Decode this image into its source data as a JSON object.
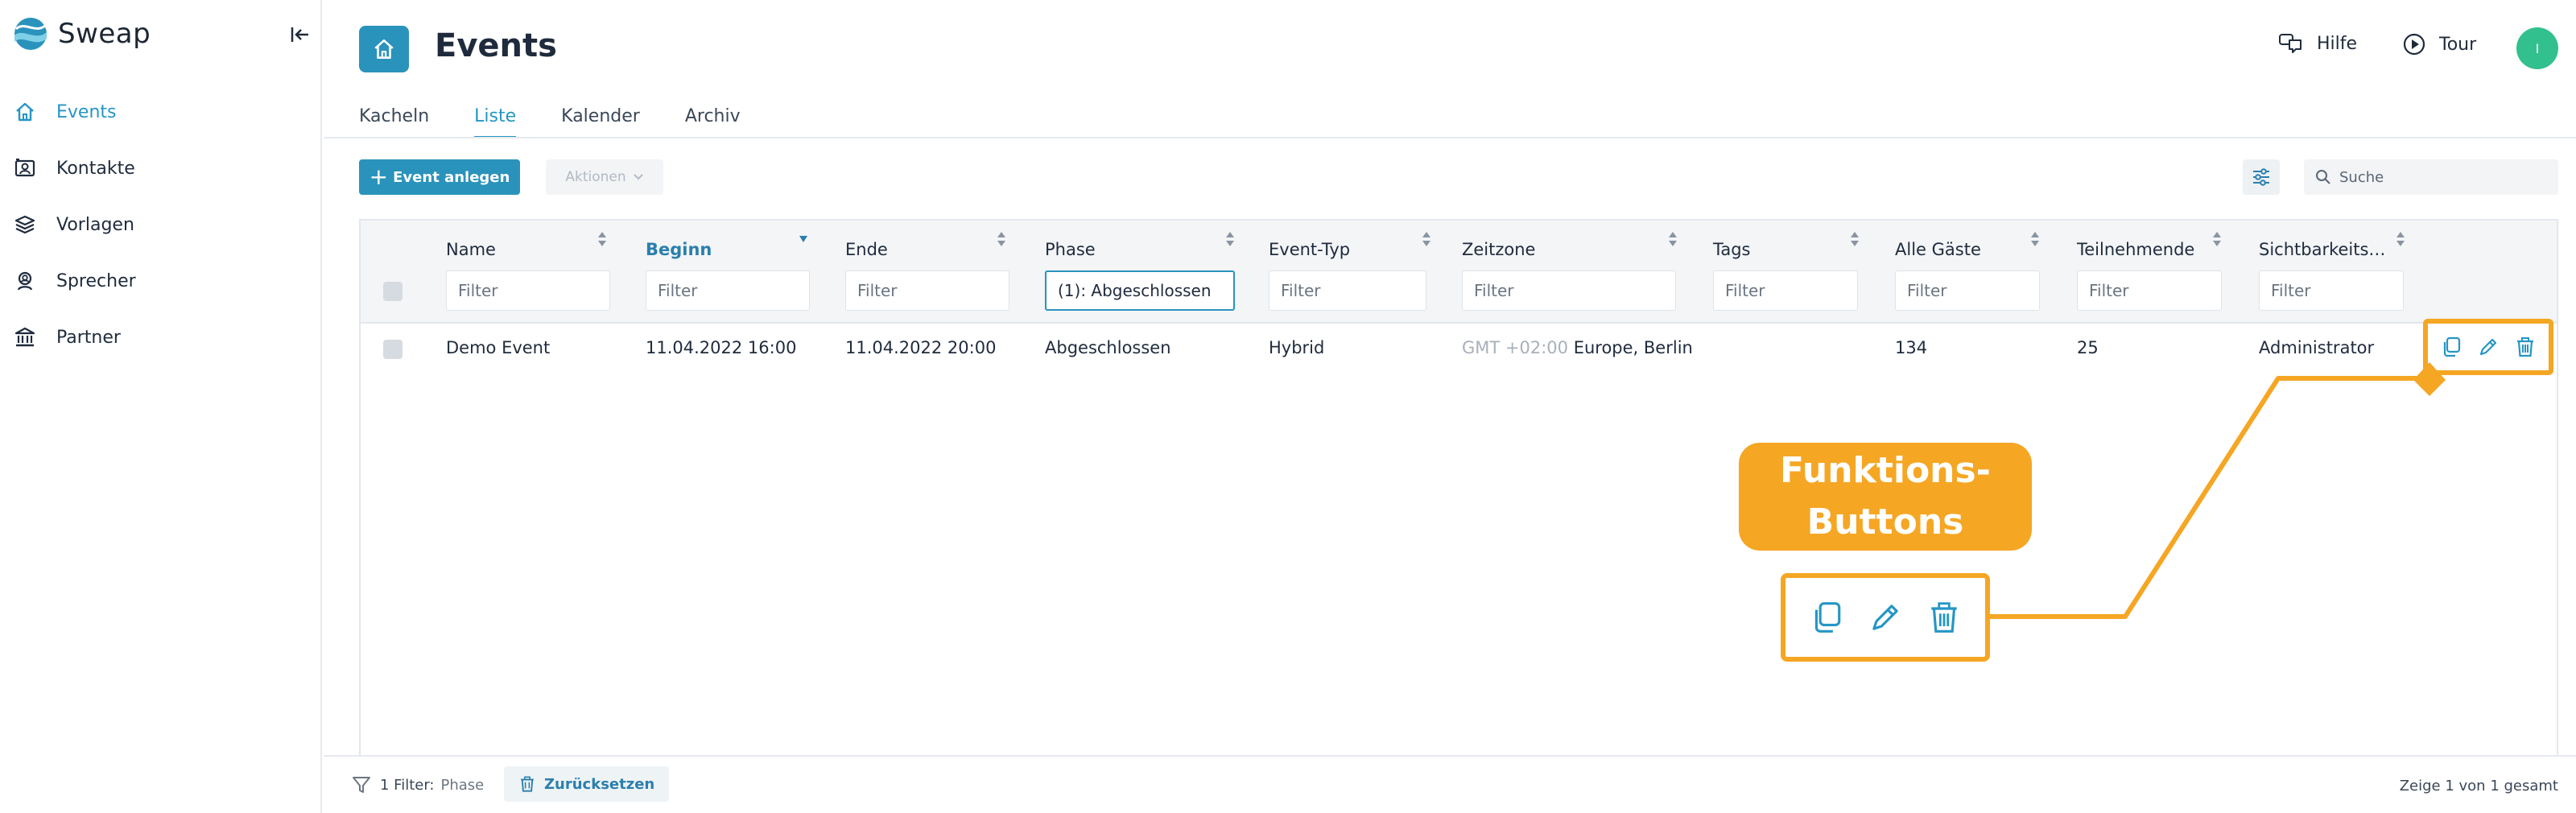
{
  "app": {
    "brand": "Sweap",
    "accent_color": "#2a93bc",
    "highlight_color": "#f5a623"
  },
  "sidebar": {
    "collapse_icon": "collapse-left-icon",
    "items": [
      {
        "label": "Events",
        "icon": "home-icon",
        "active": true
      },
      {
        "label": "Kontakte",
        "icon": "contact-card-icon",
        "active": false
      },
      {
        "label": "Vorlagen",
        "icon": "layers-icon",
        "active": false
      },
      {
        "label": "Sprecher",
        "icon": "speaker-icon",
        "active": false
      },
      {
        "label": "Partner",
        "icon": "bank-icon",
        "active": false
      }
    ]
  },
  "header": {
    "title": "Events",
    "help_label": "Hilfe",
    "tour_label": "Tour",
    "avatar_initial": "I"
  },
  "tabs": [
    {
      "label": "Kacheln",
      "active": false
    },
    {
      "label": "Liste",
      "active": true
    },
    {
      "label": "Kalender",
      "active": false
    },
    {
      "label": "Archiv",
      "active": false
    }
  ],
  "toolbar": {
    "create_label": "Event anlegen",
    "actions_label": "Aktionen",
    "search_placeholder": "Suche"
  },
  "table": {
    "columns": [
      {
        "label": "Name",
        "filter": "",
        "sorted": false
      },
      {
        "label": "Beginn",
        "filter": "",
        "sorted": true
      },
      {
        "label": "Ende",
        "filter": "",
        "sorted": false
      },
      {
        "label": "Phase",
        "filter": "(1): Abgeschlossen",
        "sorted": false
      },
      {
        "label": "Event-Typ",
        "filter": "",
        "sorted": false
      },
      {
        "label": "Zeitzone",
        "filter": "",
        "sorted": false
      },
      {
        "label": "Tags",
        "filter": "",
        "sorted": false
      },
      {
        "label": "Alle Gäste",
        "filter": "",
        "sorted": false
      },
      {
        "label": "Teilnehmende",
        "filter": "",
        "sorted": false
      },
      {
        "label": "Sichtbarkeits…",
        "filter": "",
        "sorted": false
      }
    ],
    "filter_placeholder": "Filter",
    "rows": [
      {
        "name": "Demo Event",
        "beginn": "11.04.2022 16:00",
        "ende": "11.04.2022 20:00",
        "phase": "Abgeschlossen",
        "event_typ": "Hybrid",
        "zeitzone_offset": "GMT +02:00",
        "zeitzone_name": "Europe, Berlin",
        "tags": "",
        "alle_gaeste": "134",
        "teilnehmende": "25",
        "sichtbarkeit": "Administrator"
      }
    ]
  },
  "footer": {
    "filter_count": "1 Filter:",
    "filter_field": "Phase",
    "reset_label": "Zurücksetzen",
    "pager_text": "Zeige 1 von 1 gesamt"
  },
  "callout": {
    "label": "Funktions-Buttons",
    "icons": [
      "copy-icon",
      "edit-pencil-icon",
      "trash-icon"
    ]
  }
}
